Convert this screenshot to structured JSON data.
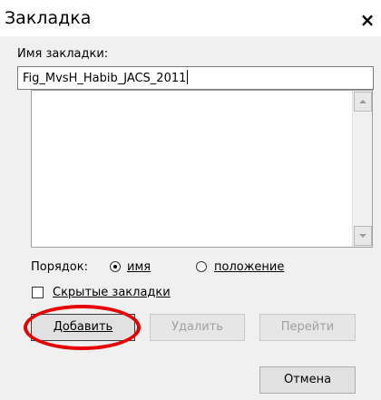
{
  "window": {
    "title": "Закладка",
    "close_glyph": "×"
  },
  "bookmark_name": {
    "label": "Имя закладки:",
    "value": "Fig_MvsH_Habib_JACS_2011"
  },
  "bookmark_list": {
    "items": []
  },
  "sort": {
    "label": "Порядок:",
    "options": [
      {
        "label": "имя",
        "selected": true
      },
      {
        "label": "положение",
        "selected": false
      }
    ]
  },
  "hidden_bookmarks": {
    "label": "Скрытые закладки",
    "checked": false
  },
  "buttons": {
    "add": "Добавить",
    "delete": "Удалить",
    "goto": "Перейти",
    "cancel": "Отмена"
  },
  "annotation": {
    "highlight_color": "#e60000"
  }
}
